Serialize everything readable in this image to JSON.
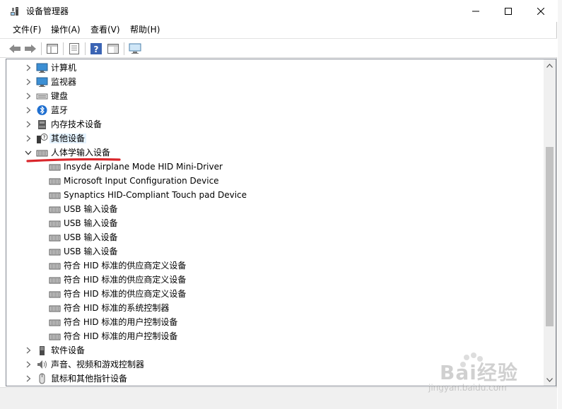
{
  "window": {
    "title": "设备管理器"
  },
  "menu": [
    {
      "label": "文件(F)"
    },
    {
      "label": "操作(A)"
    },
    {
      "label": "查看(V)"
    },
    {
      "label": "帮助(H)"
    }
  ],
  "toolbar": {
    "icons": [
      "back-arrow-icon",
      "forward-arrow-icon",
      "show-hide-tree-icon",
      "properties-icon",
      "help-icon",
      "action-pane-icon",
      "monitor-icon"
    ]
  },
  "tree": {
    "items": [
      {
        "label": "计算机",
        "icon": "computer-icon",
        "level": 0,
        "expandable": true,
        "expanded": false
      },
      {
        "label": "监视器",
        "icon": "monitor-icon",
        "level": 0,
        "expandable": true,
        "expanded": false
      },
      {
        "label": "键盘",
        "icon": "keyboard-icon",
        "level": 0,
        "expandable": true,
        "expanded": false
      },
      {
        "label": "蓝牙",
        "icon": "bluetooth-icon",
        "level": 0,
        "expandable": true,
        "expanded": false
      },
      {
        "label": "内存技术设备",
        "icon": "memory-device-icon",
        "level": 0,
        "expandable": true,
        "expanded": false
      },
      {
        "label": "其他设备",
        "icon": "unknown-device-icon",
        "level": 0,
        "expandable": true,
        "expanded": false,
        "highlighted": true
      },
      {
        "label": "人体学输入设备",
        "icon": "hid-icon",
        "level": 0,
        "expandable": true,
        "expanded": true
      },
      {
        "label": "Insyde Airplane Mode HID Mini-Driver",
        "icon": "hid-icon",
        "level": 1
      },
      {
        "label": "Microsoft Input Configuration Device",
        "icon": "hid-icon",
        "level": 1
      },
      {
        "label": "Synaptics HID-Compliant Touch pad Device",
        "icon": "hid-icon",
        "level": 1
      },
      {
        "label": "USB 输入设备",
        "icon": "hid-icon",
        "level": 1
      },
      {
        "label": "USB 输入设备",
        "icon": "hid-icon",
        "level": 1
      },
      {
        "label": "USB 输入设备",
        "icon": "hid-icon",
        "level": 1
      },
      {
        "label": "USB 输入设备",
        "icon": "hid-icon",
        "level": 1
      },
      {
        "label": "符合 HID 标准的供应商定义设备",
        "icon": "hid-icon",
        "level": 1
      },
      {
        "label": "符合 HID 标准的供应商定义设备",
        "icon": "hid-icon",
        "level": 1
      },
      {
        "label": "符合 HID 标准的供应商定义设备",
        "icon": "hid-icon",
        "level": 1
      },
      {
        "label": "符合 HID 标准的系统控制器",
        "icon": "hid-icon",
        "level": 1
      },
      {
        "label": "符合 HID 标准的用户控制设备",
        "icon": "hid-icon",
        "level": 1
      },
      {
        "label": "符合 HID 标准的用户控制设备",
        "icon": "hid-icon",
        "level": 1
      },
      {
        "label": "软件设备",
        "icon": "software-device-icon",
        "level": 0,
        "expandable": true,
        "expanded": false
      },
      {
        "label": "声音、视频和游戏控制器",
        "icon": "sound-icon",
        "level": 0,
        "expandable": true,
        "expanded": false
      },
      {
        "label": "鼠标和其他指针设备",
        "icon": "mouse-icon",
        "level": 0,
        "expandable": true,
        "expanded": false
      }
    ]
  },
  "watermark": {
    "brand": "Bai经验",
    "url": "jingyan.baidu.com"
  },
  "colors": {
    "annotation_red": "#d9262b",
    "highlight": "#e5f3ff"
  }
}
